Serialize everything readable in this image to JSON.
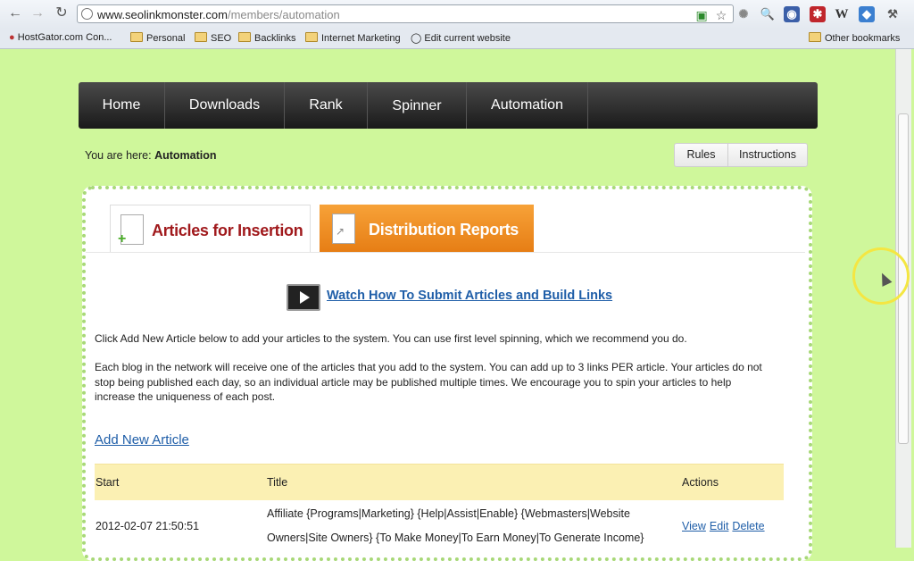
{
  "browser": {
    "url_host": "www.seolinkmonster.com",
    "url_path": "/members/automation",
    "bookmarks": [
      "HostGator.com Con...",
      "Personal",
      "SEO",
      "Backlinks",
      "Internet Marketing",
      "Edit current website"
    ],
    "other_bookmarks": "Other bookmarks",
    "ext_w": "W"
  },
  "nav": {
    "items": [
      "Home",
      "Downloads",
      "Rank",
      "Spinner",
      "Automation"
    ]
  },
  "breadcrumb": {
    "prefix": "You are here:",
    "current": "Automation"
  },
  "buttons": {
    "rules": "Rules",
    "instructions": "Instructions"
  },
  "tabs": {
    "active": "Articles for Insertion",
    "other": "Distribution Reports"
  },
  "content": {
    "video_link": "Watch How To Submit Articles and Build Links",
    "para1": "Click Add New Article below to add your articles to the system. You can use first level spinning, which we recommend you do.",
    "para2": "Each blog in the network will receive one of the articles that you add to the system. You can add up to 3 links PER article. Your articles do not stop being published each day, so an individual article may be published multiple times. We encourage you to spin your articles to help increase the uniqueness of each post.",
    "add_link": "Add New Article"
  },
  "table": {
    "headers": {
      "start": "Start",
      "title": "Title",
      "actions": "Actions"
    },
    "rows": [
      {
        "start": "2012-02-07 21:50:51",
        "title_line1": "Affiliate {Programs|Marketing} {Help|Assist|Enable} {Webmasters|Website",
        "title_line2": "Owners|Site Owners} {To Make Money|To Earn Money|To Generate Income}",
        "view": "View",
        "edit": "Edit",
        "delete": "Delete"
      }
    ]
  }
}
